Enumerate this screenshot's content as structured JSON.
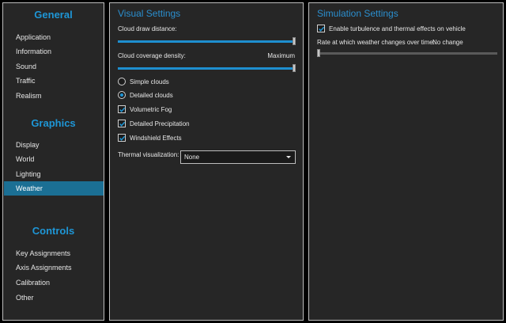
{
  "sidebar": {
    "sections": [
      {
        "title": "General",
        "items": [
          "Application",
          "Information",
          "Sound",
          "Traffic",
          "Realism"
        ]
      },
      {
        "title": "Graphics",
        "items": [
          "Display",
          "World",
          "Lighting",
          "Weather"
        ]
      },
      {
        "title": "Controls",
        "items": [
          "Key Assignments",
          "Axis Assignments",
          "Calibration",
          "Other"
        ]
      }
    ],
    "active_item": "Weather"
  },
  "visual_settings": {
    "title": "Visual Settings",
    "cloud_draw_distance": {
      "label": "Cloud draw distance:",
      "value_fraction": 1.0
    },
    "cloud_coverage_density": {
      "label": "Cloud coverage density:",
      "value_text": "Maximum",
      "value_fraction": 1.0
    },
    "cloud_mode": {
      "options": [
        "Simple clouds",
        "Detailed clouds"
      ],
      "selected": "Detailed clouds"
    },
    "checkboxes": [
      {
        "label": "Volumetric Fog",
        "checked": true
      },
      {
        "label": "Detailed Precipitation",
        "checked": true
      },
      {
        "label": "Windshield Effects",
        "checked": true
      }
    ],
    "thermal_visualization": {
      "label": "Thermal visualization:",
      "value": "None"
    }
  },
  "simulation_settings": {
    "title": "Simulation Settings",
    "turbulence": {
      "label": "Enable turbulence and thermal effects on vehicle",
      "checked": true
    },
    "weather_change_rate": {
      "label": "Rate at which weather changes over time:",
      "value_text": "No change",
      "value_fraction": 0.0
    }
  },
  "colors": {
    "accent": "#1e96d6",
    "selected_bg": "#1b6f94",
    "panel_bg": "#262626"
  }
}
